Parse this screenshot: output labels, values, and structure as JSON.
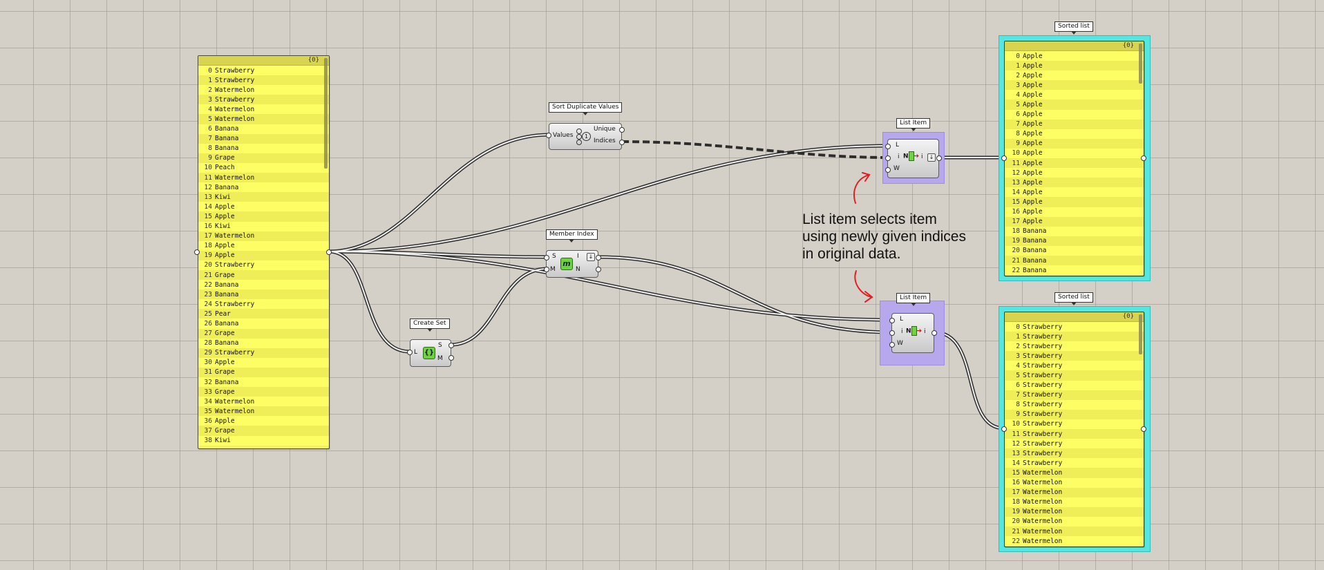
{
  "input_panel": {
    "header": "{0}",
    "items": [
      "Strawberry",
      "Strawberry",
      "Watermelon",
      "Strawberry",
      "Watermelon",
      "Watermelon",
      "Banana",
      "Banana",
      "Banana",
      "Grape",
      "Peach",
      "Watermelon",
      "Banana",
      "Kiwi",
      "Apple",
      "Apple",
      "Kiwi",
      "Watermelon",
      "Apple",
      "Apple",
      "Strawberry",
      "Grape",
      "Banana",
      "Banana",
      "Strawberry",
      "Pear",
      "Banana",
      "Grape",
      "Banana",
      "Strawberry",
      "Apple",
      "Grape",
      "Banana",
      "Grape",
      "Watermelon",
      "Watermelon",
      "Apple",
      "Grape",
      "Kiwi"
    ]
  },
  "sort_duplicates": {
    "tag": "Sort Duplicate Values",
    "input": "Values",
    "out_unique": "Unique",
    "out_indices": "Indices",
    "icon": "1"
  },
  "member_index": {
    "tag": "Member Index",
    "in_s": "S",
    "in_m": "M",
    "out_i": "I",
    "out_n": "N",
    "icon": "m"
  },
  "create_set": {
    "tag": "Create Set",
    "in_l": "L",
    "out_s": "S",
    "out_m": "M",
    "icon": "{}"
  },
  "list_item_top": {
    "tag": "List Item",
    "in_l": "L",
    "in_i": "i",
    "in_w": "W",
    "out_i": "i"
  },
  "list_item_bottom": {
    "tag": "List Item",
    "in_l": "L",
    "in_i": "i",
    "in_w": "W",
    "out_i": "i"
  },
  "annotation": "List item selects item\nusing newly given indices\nin original data.",
  "sorted_top": {
    "tag": "Sorted list",
    "header": "{0}",
    "items": [
      "Apple",
      "Apple",
      "Apple",
      "Apple",
      "Apple",
      "Apple",
      "Apple",
      "Apple",
      "Apple",
      "Apple",
      "Apple",
      "Apple",
      "Apple",
      "Apple",
      "Apple",
      "Apple",
      "Apple",
      "Apple",
      "Banana",
      "Banana",
      "Banana",
      "Banana",
      "Banana"
    ]
  },
  "sorted_bottom": {
    "tag": "Sorted list",
    "header": "{0}",
    "items": [
      "Strawberry",
      "Strawberry",
      "Strawberry",
      "Strawberry",
      "Strawberry",
      "Strawberry",
      "Strawberry",
      "Strawberry",
      "Strawberry",
      "Strawberry",
      "Strawberry",
      "Strawberry",
      "Strawberry",
      "Strawberry",
      "Strawberry",
      "Watermelon",
      "Watermelon",
      "Watermelon",
      "Watermelon",
      "Watermelon",
      "Watermelon",
      "Watermelon",
      "Watermelon"
    ]
  },
  "colors": {
    "panel": "#f4f06a",
    "output_frame": "#56e6e2",
    "list_item_bg": "#b7a7ec",
    "annotation_arrow": "#e02020"
  }
}
